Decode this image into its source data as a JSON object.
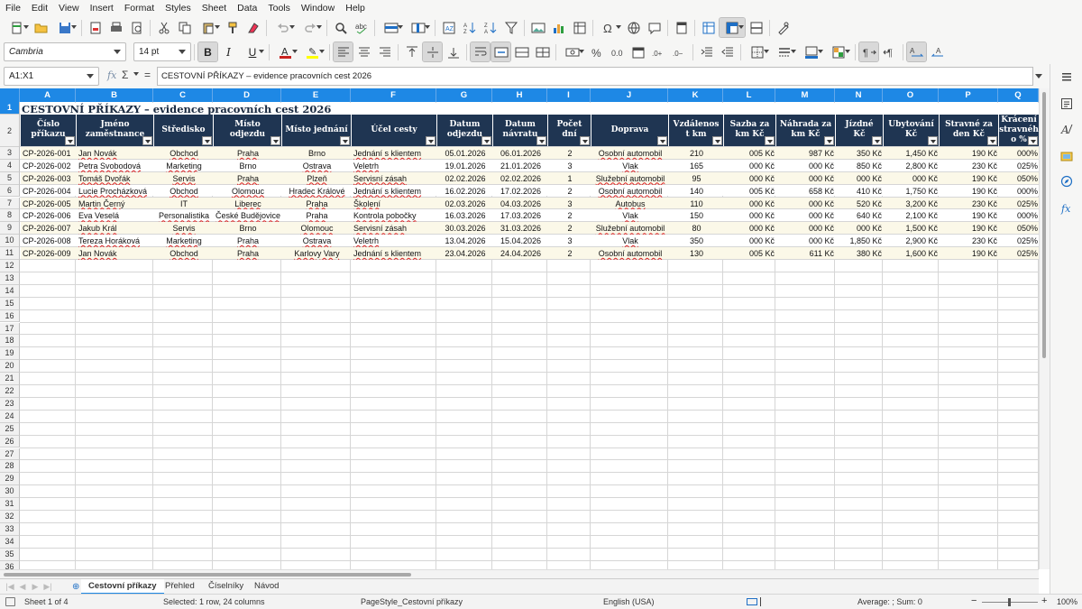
{
  "menu": [
    "File",
    "Edit",
    "View",
    "Insert",
    "Format",
    "Styles",
    "Sheet",
    "Data",
    "Tools",
    "Window",
    "Help"
  ],
  "toolbar": {
    "font_name": "Cambria",
    "font_size": "14 pt",
    "bold_label": "B",
    "italic_label": "I",
    "underline_label": "U",
    "accent_color": "#1e88e5",
    "font_color": "#c9211e",
    "highlight_color": "#ffff00",
    "icons_row1": [
      "new-icon",
      "open-icon",
      "save-icon",
      "export-pdf-icon",
      "print-icon",
      "print-preview-icon",
      "cut-icon",
      "copy-icon",
      "paste-icon",
      "clone-format-icon",
      "clear-format-icon",
      "undo-icon",
      "redo-icon",
      "find-replace-icon",
      "spelling-icon",
      "row-icon",
      "column-icon",
      "sort-icon",
      "sort-ascending-icon",
      "sort-descending-icon",
      "autofilter-icon",
      "image-icon",
      "chart-icon",
      "pivot-table-icon",
      "special-character-icon",
      "hyperlink-icon",
      "comment-icon",
      "headers-footers-icon",
      "define-print-area-icon",
      "freeze-rows-columns-icon",
      "split-window-icon",
      "show-draw-functions-icon"
    ],
    "icons_row2": [
      "align-left-icon",
      "align-center-icon",
      "align-right-icon",
      "align-top-icon",
      "align-middle-icon",
      "align-bottom-icon",
      "wrap-text-icon",
      "merge-center-icon",
      "merge-cells-icon",
      "unmerge-cells-icon",
      "currency-format-icon",
      "percent-format-icon",
      "number-format-icon",
      "date-format-icon",
      "add-decimal-icon",
      "delete-decimal-icon",
      "increase-indent-icon",
      "decrease-indent-icon",
      "borders-icon",
      "border-style-icon",
      "border-color-icon",
      "conditional-format-icon",
      "left-to-right-icon",
      "right-to-left-icon",
      "text-ltr-icon",
      "text-rtl-icon"
    ]
  },
  "formula_bar": {
    "name_box": "A1:X1",
    "function_wizard": "fx",
    "sum_symbol": "Σ",
    "equals_symbol": "=",
    "content": "CESTOVNÍ PŘÍKAZY – evidence pracovních cest 2026"
  },
  "columns": [
    "A",
    "B",
    "C",
    "D",
    "E",
    "F",
    "G",
    "H",
    "I",
    "J",
    "K",
    "L",
    "M",
    "N",
    "O",
    "P",
    "Q"
  ],
  "row_numbers": [
    "1",
    "2",
    "3",
    "4",
    "5",
    "6",
    "7",
    "8",
    "9",
    "10",
    "11",
    "12",
    "13",
    "14",
    "15",
    "16",
    "17",
    "18",
    "19",
    "20",
    "21",
    "22",
    "23",
    "24",
    "25",
    "26",
    "27",
    "28",
    "29",
    "30",
    "31",
    "32",
    "33",
    "34",
    "35",
    "36"
  ],
  "sheet": {
    "title": "CESTOVNÍ PŘÍKAZY – evidence pracovních cest 2026",
    "headers": [
      [
        "Číslo",
        "příkazu"
      ],
      [
        "Jméno",
        "zaměstnance"
      ],
      [
        "Středisko"
      ],
      [
        "Místo",
        "odjezdu"
      ],
      [
        "Místo jednání"
      ],
      [
        "Účel cesty"
      ],
      [
        "Datum",
        "odjezdu"
      ],
      [
        "Datum",
        "návratu"
      ],
      [
        "Počet",
        "dní"
      ],
      [
        "Doprava"
      ],
      [
        "Vzdálenos",
        "t km"
      ],
      [
        "Sazba za",
        "km Kč"
      ],
      [
        "Náhrada za",
        "km Kč"
      ],
      [
        "Jízdné",
        "Kč"
      ],
      [
        "Ubytování",
        "Kč"
      ],
      [
        "Stravné za",
        "den Kč"
      ],
      [
        "Krácení",
        "stravnéh",
        "o %"
      ]
    ],
    "rows": [
      [
        "CP-2026-001",
        "Jan Novák",
        "Obchod",
        "Praha",
        "Brno",
        "Jednání s klientem",
        "05.01.2026",
        "06.01.2026",
        "2",
        "Osobní automobil",
        "210",
        "005 Kč",
        "987 Kč",
        "350 Kč",
        "1,450 Kč",
        "190 Kč",
        "000%"
      ],
      [
        "CP-2026-002",
        "Petra Svobodová",
        "Marketing",
        "Brno",
        "Ostrava",
        "Veletrh",
        "19.01.2026",
        "21.01.2026",
        "3",
        "Vlak",
        "165",
        "000 Kč",
        "000 Kč",
        "850 Kč",
        "2,800 Kč",
        "230 Kč",
        "025%"
      ],
      [
        "CP-2026-003",
        "Tomáš Dvořák",
        "Servis",
        "Praha",
        "Plzeň",
        "Servisní zásah",
        "02.02.2026",
        "02.02.2026",
        "1",
        "Služební automobil",
        "95",
        "000 Kč",
        "000 Kč",
        "000 Kč",
        "000 Kč",
        "190 Kč",
        "050%"
      ],
      [
        "CP-2026-004",
        "Lucie Procházková",
        "Obchod",
        "Olomouc",
        "Hradec Králové",
        "Jednání s klientem",
        "16.02.2026",
        "17.02.2026",
        "2",
        "Osobní automobil",
        "140",
        "005 Kč",
        "658 Kč",
        "410 Kč",
        "1,750 Kč",
        "190 Kč",
        "000%"
      ],
      [
        "CP-2026-005",
        "Martin Černý",
        "IT",
        "Liberec",
        "Praha",
        "Školení",
        "02.03.2026",
        "04.03.2026",
        "3",
        "Autobus",
        "110",
        "000 Kč",
        "000 Kč",
        "520 Kč",
        "3,200 Kč",
        "230 Kč",
        "025%"
      ],
      [
        "CP-2026-006",
        "Eva Veselá",
        "Personalistika",
        "České Budějovice",
        "Praha",
        "Kontrola pobočky",
        "16.03.2026",
        "17.03.2026",
        "2",
        "Vlak",
        "150",
        "000 Kč",
        "000 Kč",
        "640 Kč",
        "2,100 Kč",
        "190 Kč",
        "000%"
      ],
      [
        "CP-2026-007",
        "Jakub Král",
        "Servis",
        "Brno",
        "Olomouc",
        "Servisní zásah",
        "30.03.2026",
        "31.03.2026",
        "2",
        "Služební automobil",
        "80",
        "000 Kč",
        "000 Kč",
        "000 Kč",
        "1,500 Kč",
        "190 Kč",
        "050%"
      ],
      [
        "CP-2026-008",
        "Tereza Horáková",
        "Marketing",
        "Praha",
        "Ostrava",
        "Veletrh",
        "13.04.2026",
        "15.04.2026",
        "3",
        "Vlak",
        "350",
        "000 Kč",
        "000 Kč",
        "1,850 Kč",
        "2,900 Kč",
        "230 Kč",
        "025%"
      ],
      [
        "CP-2026-009",
        "Jan Novák",
        "Obchod",
        "Praha",
        "Karlovy Vary",
        "Jednání s klientem",
        "23.04.2026",
        "24.04.2026",
        "2",
        "Osobní automobil",
        "130",
        "005 Kč",
        "611 Kč",
        "380 Kč",
        "1,600 Kč",
        "190 Kč",
        "025%"
      ]
    ]
  },
  "tabs": [
    "Cestovní příkazy",
    "Přehled",
    "Číselníky",
    "Návod"
  ],
  "status": {
    "sheet": "Sheet 1 of 4",
    "selection": "Selected: 1 row, 24 columns",
    "page_style": "PageStyle_Cestovní příkazy",
    "language": "English (USA)",
    "summary": "Average: ; Sum: 0",
    "zoom": "100%",
    "zoom_minus": "−",
    "zoom_plus": "+"
  }
}
